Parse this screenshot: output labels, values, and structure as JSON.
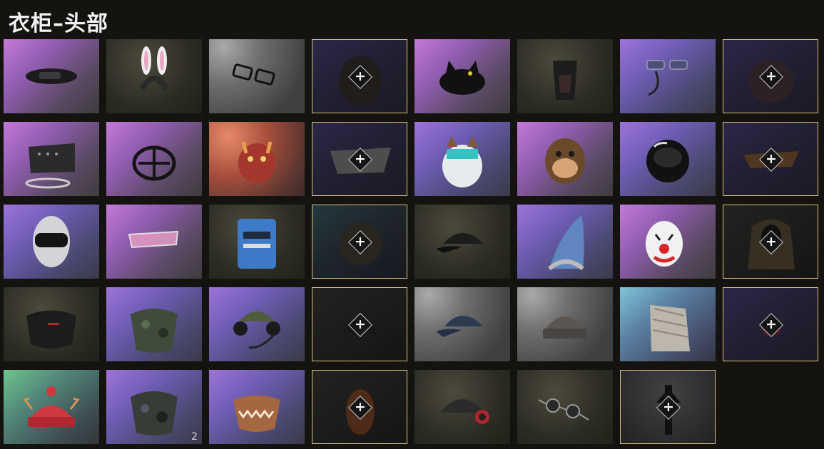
{
  "title": "衣柜–头部",
  "add_symbol": "+",
  "items": [
    {
      "name": "eyepatch-mask",
      "bg": "purple",
      "locked": false
    },
    {
      "name": "bunny-ears-headband",
      "bg": "dark",
      "locked": false
    },
    {
      "name": "glasses",
      "bg": "grey",
      "locked": false
    },
    {
      "name": "bear-hood",
      "bg": "locked",
      "locked": true
    },
    {
      "name": "cat-beanie",
      "bg": "purple",
      "locked": false
    },
    {
      "name": "tactical-mask",
      "bg": "dark",
      "locked": false
    },
    {
      "name": "headset-glasses",
      "bg": "violet",
      "locked": false
    },
    {
      "name": "red-hood",
      "bg": "locked",
      "locked": true
    },
    {
      "name": "spiked-mask",
      "bg": "purple",
      "locked": false
    },
    {
      "name": "muzzle-mask",
      "bg": "purple",
      "locked": false
    },
    {
      "name": "oni-mask",
      "bg": "red",
      "locked": false
    },
    {
      "name": "bandana",
      "bg": "locked",
      "locked": true
    },
    {
      "name": "owl-hat",
      "bg": "violet",
      "locked": false
    },
    {
      "name": "chimp-mask",
      "bg": "purple",
      "locked": false
    },
    {
      "name": "space-helmet",
      "bg": "violet",
      "locked": false
    },
    {
      "name": "aviator-hat",
      "bg": "locked",
      "locked": true
    },
    {
      "name": "ninja-hood",
      "bg": "violet",
      "locked": false
    },
    {
      "name": "visor-glasses",
      "bg": "purple",
      "locked": false
    },
    {
      "name": "knight-helmet",
      "bg": "dark",
      "locked": false
    },
    {
      "name": "diving-helmet",
      "bg": "locked-teal",
      "locked": true
    },
    {
      "name": "black-cap",
      "bg": "dark",
      "locked": false
    },
    {
      "name": "gnome-hat",
      "bg": "violet",
      "locked": false
    },
    {
      "name": "clown-mask",
      "bg": "purple",
      "locked": false
    },
    {
      "name": "scarf-hood",
      "bg": "locked-dark",
      "locked": true
    },
    {
      "name": "face-mask",
      "bg": "dark",
      "locked": false
    },
    {
      "name": "camo-neck-gaiter",
      "bg": "violet",
      "locked": false
    },
    {
      "name": "pilot-headset-cap",
      "bg": "violet",
      "locked": false
    },
    {
      "name": "black-beanie",
      "bg": "locked-dark",
      "locked": true
    },
    {
      "name": "denim-cap",
      "bg": "grey",
      "locked": false
    },
    {
      "name": "knit-beanie",
      "bg": "grey",
      "locked": false
    },
    {
      "name": "hooded-scarf",
      "bg": "teal",
      "locked": false
    },
    {
      "name": "red-badge",
      "bg": "locked",
      "locked": true
    },
    {
      "name": "reindeer-beanie",
      "bg": "green",
      "locked": false
    },
    {
      "name": "camo-face-mask",
      "bg": "violet",
      "locked": false,
      "count": "2"
    },
    {
      "name": "monster-mouth-mask",
      "bg": "violet",
      "locked": false
    },
    {
      "name": "pumpkin-mask",
      "bg": "locked-dark",
      "locked": true
    },
    {
      "name": "headphone-beanie",
      "bg": "dark",
      "locked": false
    },
    {
      "name": "round-sunglasses",
      "bg": "dark",
      "locked": false
    },
    {
      "name": "ninja-headband",
      "bg": "slate",
      "locked": true
    }
  ]
}
